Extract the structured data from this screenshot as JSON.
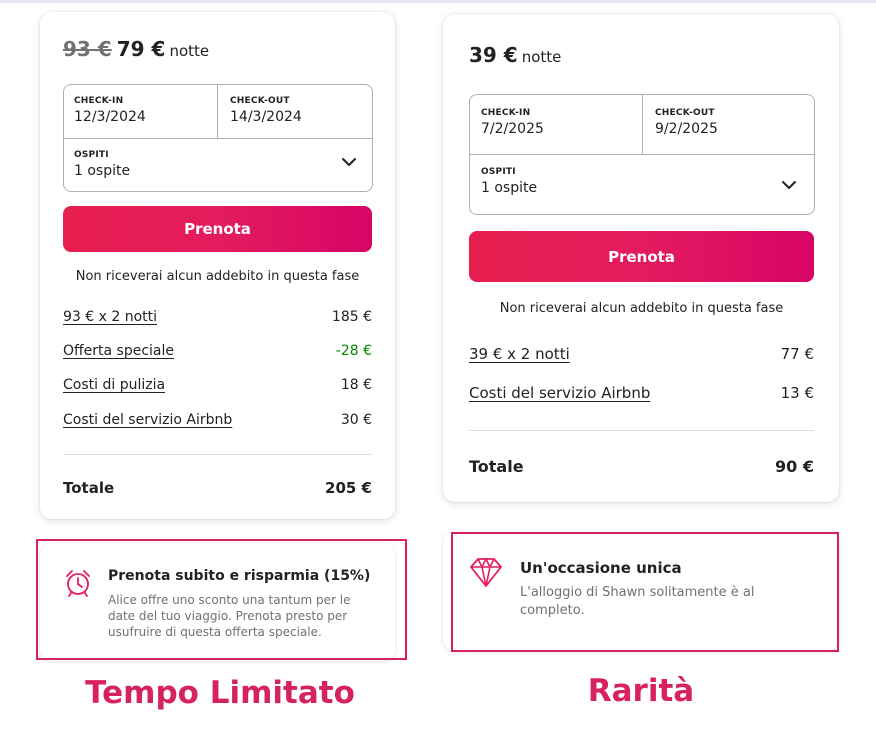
{
  "left": {
    "price_old": "93 €",
    "price_current": "79 €",
    "price_unit": "notte",
    "checkin_label": "CHECK-IN",
    "checkin_value": "12/3/2024",
    "checkout_label": "CHECK-OUT",
    "checkout_value": "14/3/2024",
    "guests_label": "OSPITI",
    "guests_value": "1 ospite",
    "reserve_label": "Prenota",
    "note": "Non riceverai alcun addebito in questa fase",
    "rows": [
      {
        "label": "93 € x 2 notti",
        "value": "185 €"
      },
      {
        "label": "Offerta speciale",
        "value": "-28 €"
      },
      {
        "label": "Costi di pulizia",
        "value": "18 €"
      },
      {
        "label": "Costi del servizio Airbnb",
        "value": "30 €"
      }
    ],
    "total_label": "Totale",
    "total_value": "205 €",
    "promo_title": "Prenota subito e risparmia (15%)",
    "promo_desc": "Alice offre uno sconto una tantum per le date del tuo viaggio. Prenota presto per usufruire di questa offerta speciale.",
    "promo_icon": "alarm-clock-icon",
    "caption": "Tempo Limitato"
  },
  "right": {
    "price_current": "39 €",
    "price_unit": "notte",
    "checkin_label": "CHECK-IN",
    "checkin_value": "7/2/2025",
    "checkout_label": "CHECK-OUT",
    "checkout_value": "9/2/2025",
    "guests_label": "OSPITI",
    "guests_value": "1 ospite",
    "reserve_label": "Prenota",
    "note": "Non riceverai alcun addebito in questa fase",
    "rows": [
      {
        "label": "39 € x 2 notti",
        "value": "77 €"
      },
      {
        "label": "Costi del servizio Airbnb",
        "value": "13 €"
      }
    ],
    "total_label": "Totale",
    "total_value": "90 €",
    "promo_title": "Un'occasione unica",
    "promo_desc": "L'alloggio di Shawn solitamente è al completo.",
    "promo_icon": "diamond-icon",
    "caption": "Rarità"
  },
  "colors": {
    "brand": "#e31c5f",
    "highlight": "#d6235e",
    "discount": "#008a05",
    "muted": "#717171"
  }
}
